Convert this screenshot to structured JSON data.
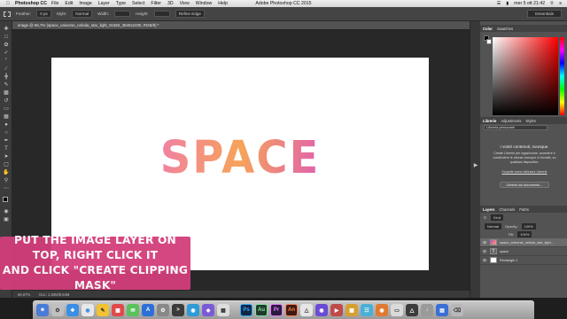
{
  "menubar": {
    "app_name": "Photoshop CC",
    "items": [
      "File",
      "Edit",
      "Image",
      "Layer",
      "Type",
      "Select",
      "Filter",
      "3D",
      "View",
      "Window",
      "Help"
    ],
    "window_title": "Adobe Photoshop CC 2015",
    "clock": "mer 5 ott 21:42"
  },
  "options": {
    "feather_label": "Feather:",
    "feather_value": "0 px",
    "style_label": "Style:",
    "style_value": "Normal",
    "width_label": "Width:",
    "height_label": "Height:",
    "refine_edge": "Refine Edge",
    "workspace": "Essentials"
  },
  "document": {
    "tab_title": "image @ 66,7% (space_universe_nebula_star_light_91550_3840x2400, RGB/8) *",
    "canvas_text": "SPACE",
    "zoom": "66,67%",
    "doc_size": "Doc: 1,93M/8,54M"
  },
  "caption": {
    "line1": "PUT THE IMAGE LAYER ON TOP, RIGHT CLICK IT",
    "line2": "AND CLICK \"CREATE CLIPPING MASK\""
  },
  "color_panel": {
    "tabs": [
      "Color",
      "Swatches"
    ],
    "fg_color": "#000000",
    "bg_color": "#ffffff"
  },
  "libraries_panel": {
    "tabs": [
      "Librerie",
      "Adjustments",
      "Styles"
    ],
    "library_select": "Libreria personale",
    "heading": "I vostri contenuti, ovunque.",
    "body": "Create Librerie per organizzare, accedere e condividere le risorse ovunque vi troviate, su qualsiasi dispositivo.",
    "link": "Scoprite come utilizzare Librerie",
    "button": "Libreria da documento..."
  },
  "layers_panel": {
    "tabs": [
      "Layers",
      "Channels",
      "Paths"
    ],
    "kind_label": "Kind",
    "blend_mode": "Normal",
    "opacity_label": "Opacity:",
    "opacity_value": "100%",
    "fill_label": "Fill:",
    "fill_value": "100%",
    "layers": [
      {
        "name": "space_universe_nebula_star_light...",
        "selected": true
      },
      {
        "name": "space",
        "selected": false
      },
      {
        "name": "Rectangle 1",
        "selected": false
      }
    ]
  },
  "dock": {
    "apps": [
      {
        "label": "Ps",
        "color": "#0f2744",
        "fg": "#31a8ff"
      },
      {
        "label": "Au",
        "color": "#1f3a2a",
        "fg": "#7fe3a1"
      },
      {
        "label": "Pr",
        "color": "#2a1a3c",
        "fg": "#ea77ff"
      },
      {
        "label": "An",
        "color": "#3c1a12",
        "fg": "#ff7c4c"
      }
    ]
  }
}
